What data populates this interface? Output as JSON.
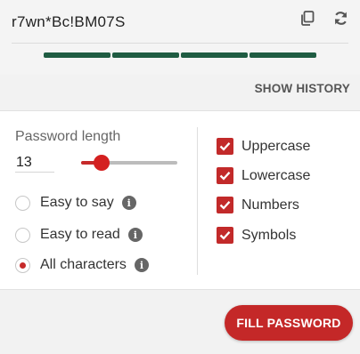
{
  "password": {
    "value": "r7wn*Bc!BM07S",
    "strength_segments_filled": 4,
    "strength_segments_total": 4,
    "strength_color": "#1f5c42"
  },
  "icons": {
    "copy": "copy-icon",
    "refresh": "refresh-icon",
    "info": "info-icon"
  },
  "history": {
    "label": "SHOW HISTORY"
  },
  "length": {
    "label": "Password length",
    "value": "13",
    "slider_fraction": 0.21
  },
  "modes": [
    {
      "label": "Easy to say",
      "checked": false
    },
    {
      "label": "Easy to read",
      "checked": false
    },
    {
      "label": "All characters",
      "checked": true
    }
  ],
  "charsets": [
    {
      "label": "Uppercase",
      "checked": true
    },
    {
      "label": "Lowercase",
      "checked": true
    },
    {
      "label": "Numbers",
      "checked": true
    },
    {
      "label": "Symbols",
      "checked": true
    }
  ],
  "footer": {
    "fill_label": "FILL PASSWORD"
  },
  "colors": {
    "accent": "#c42828",
    "text": "#222222"
  }
}
